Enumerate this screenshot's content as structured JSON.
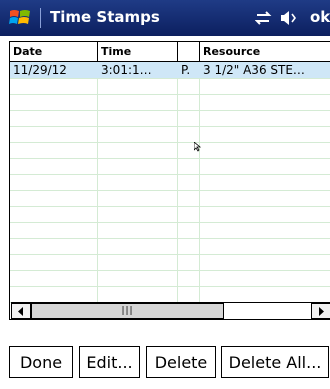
{
  "titlebar": {
    "title": "Time Stamps",
    "ok_label": "ok",
    "start_icon": "windows-start-flag-icon",
    "status_icons": [
      "connectivity-icon",
      "volume-icon"
    ]
  },
  "list": {
    "columns": [
      {
        "label": "Date"
      },
      {
        "label": "Time"
      },
      {
        "label": ""
      },
      {
        "label": "Resource"
      }
    ],
    "rows": [
      {
        "date": "11/29/12",
        "time": "3:01:1…",
        "ampm": "P.",
        "resource": "3 1/2\" A36 STE…",
        "selected": true
      }
    ],
    "empty_rows": 14
  },
  "buttons": {
    "done": "Done",
    "edit": "Edit...",
    "delete": "Delete",
    "delete_all": "Delete All..."
  },
  "colors": {
    "titlebar": "#12297a",
    "selected_row": "#cfe7f7",
    "gridline": "#d4ebd4"
  }
}
